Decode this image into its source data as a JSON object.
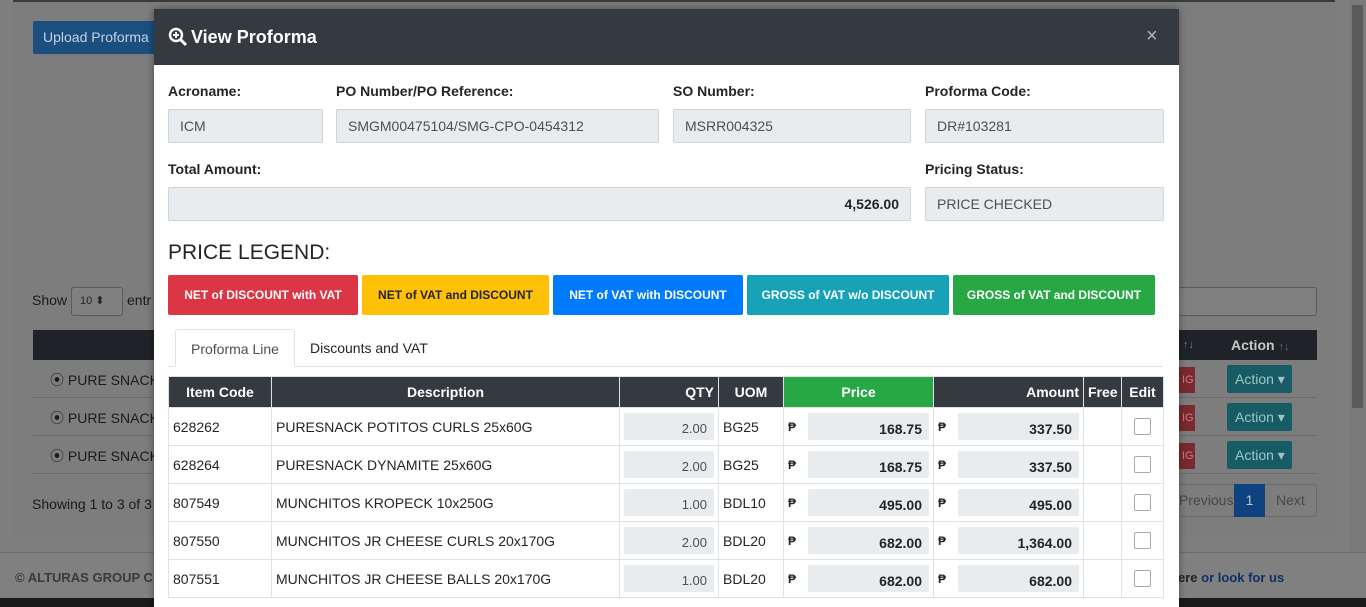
{
  "background": {
    "upload_button": "Upload Proforma",
    "show_label": "Show",
    "show_value": "10",
    "entries_label": "entr",
    "action_header": "Action",
    "rows": [
      {
        "product": "PURE SNACK",
        "action": "Action"
      },
      {
        "product": "PURE SNACK",
        "action": "Action"
      },
      {
        "product": "PURE SNACK",
        "action": "Action"
      }
    ],
    "status_badge": "IG",
    "showing": "Showing 1 to 3 of 3",
    "pager": {
      "previous": "Previous",
      "page": "1",
      "next": "Next"
    },
    "footer_copy": "© ALTURAS GROUP C",
    "footer_right_text": "ere",
    "footer_right_link": "or look for us"
  },
  "modal": {
    "title": "View Proforma",
    "close": "×",
    "fields": {
      "acroname_label": "Acroname:",
      "acroname_value": "ICM",
      "po_label": "PO Number/PO Reference:",
      "po_value": "SMGM00475104/SMG-CPO-0454312",
      "so_label": "SO Number:",
      "so_value": "MSRR004325",
      "code_label": "Proforma Code:",
      "code_value": "DR#103281",
      "total_label": "Total Amount:",
      "total_value": "4,526.00",
      "pricing_label": "Pricing Status:",
      "pricing_value": "PRICE CHECKED"
    },
    "legend_title": "PRICE LEGEND:",
    "legend": [
      {
        "label": "NET of DISCOUNT with VAT",
        "color": "#dc3545"
      },
      {
        "label": "NET of VAT and DISCOUNT",
        "color": "#ffc107"
      },
      {
        "label": "NET of VAT with DISCOUNT",
        "color": "#007bff"
      },
      {
        "label": "GROSS of VAT w/o DISCOUNT",
        "color": "#17a2b8"
      },
      {
        "label": "GROSS of VAT and DISCOUNT",
        "color": "#28a745"
      }
    ],
    "tabs": [
      "Proforma Line",
      "Discounts and VAT"
    ],
    "table": {
      "headers": [
        "Item Code",
        "Description",
        "QTY",
        "UOM",
        "Price",
        "Amount",
        "Free",
        "Edit"
      ],
      "currency": "₱",
      "rows": [
        {
          "code": "628262",
          "desc": "PURESNACK POTITOS CURLS 25x60G",
          "qty": "2.00",
          "uom": "BG25",
          "price": "168.75",
          "amount": "337.50"
        },
        {
          "code": "628264",
          "desc": "PURESNACK DYNAMITE 25x60G",
          "qty": "2.00",
          "uom": "BG25",
          "price": "168.75",
          "amount": "337.50"
        },
        {
          "code": "807549",
          "desc": "MUNCHITOS KROPECK 10x250G",
          "qty": "1.00",
          "uom": "BDL10",
          "price": "495.00",
          "amount": "495.00"
        },
        {
          "code": "807550",
          "desc": "MUNCHITOS JR CHEESE CURLS 20x170G",
          "qty": "2.00",
          "uom": "BDL20",
          "price": "682.00",
          "amount": "1,364.00"
        },
        {
          "code": "807551",
          "desc": "MUNCHITOS JR CHEESE BALLS 20x170G",
          "qty": "1.00",
          "uom": "BDL20",
          "price": "682.00",
          "amount": "682.00"
        }
      ]
    }
  }
}
